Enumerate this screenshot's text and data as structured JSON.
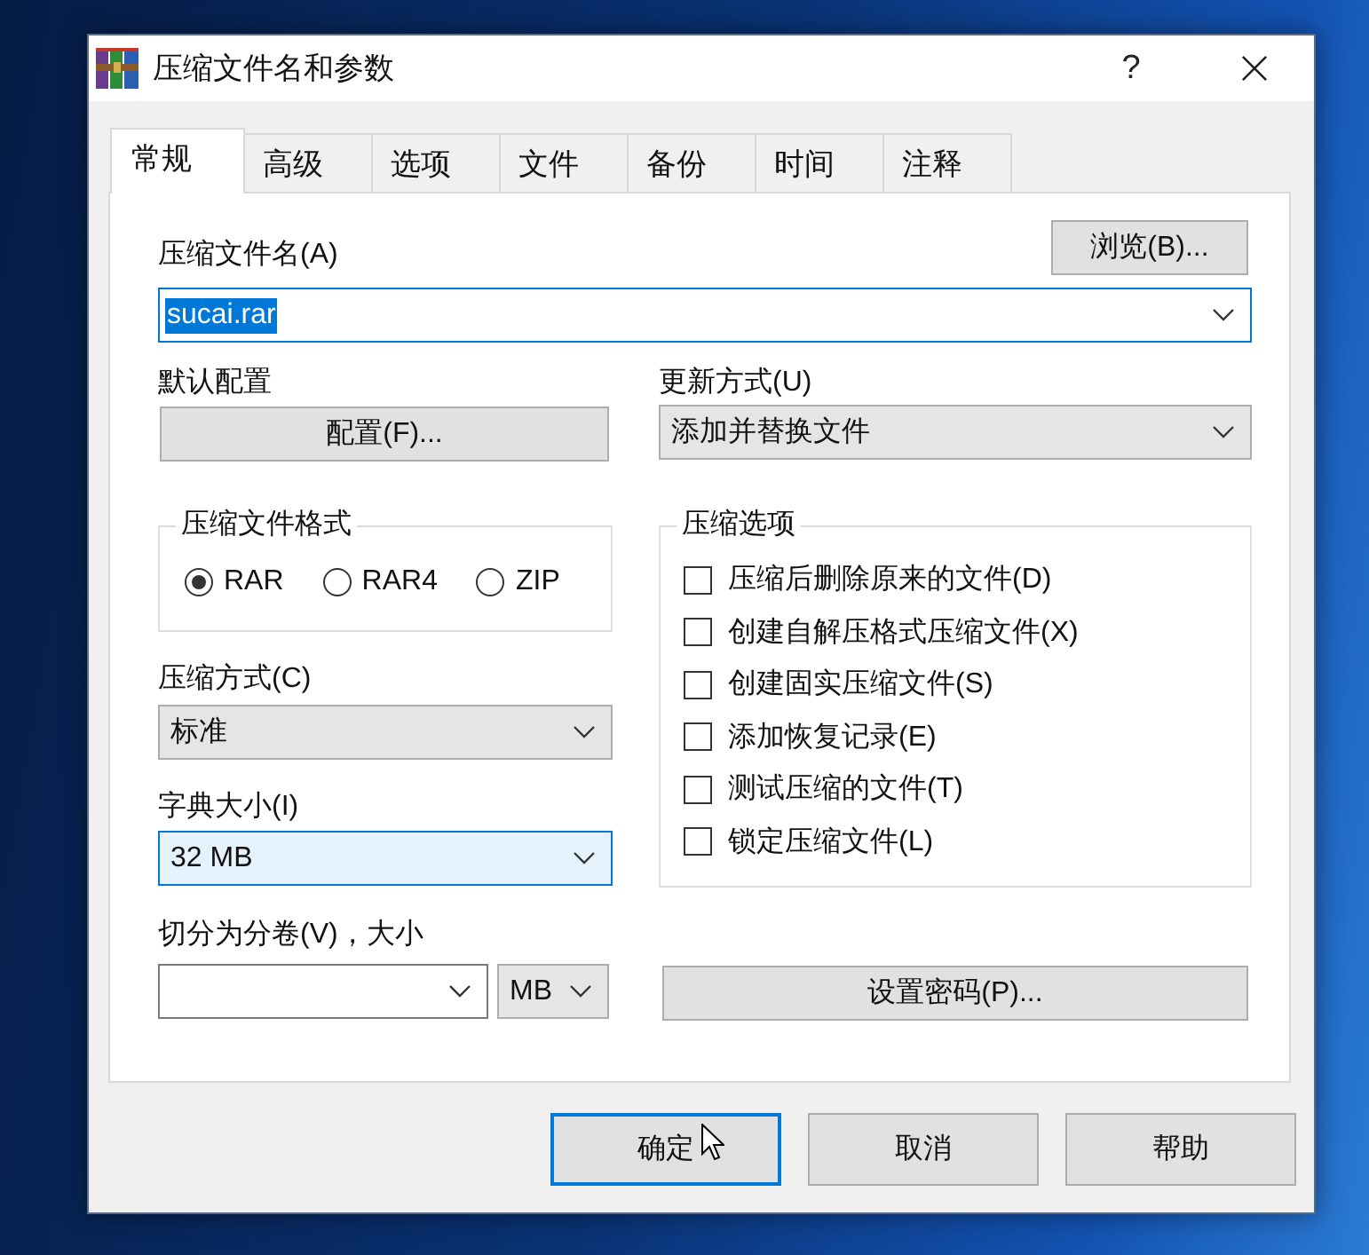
{
  "window": {
    "title": "压缩文件名和参数",
    "help_button": "?"
  },
  "tabs": [
    {
      "label": "常规",
      "selected": true
    },
    {
      "label": "高级",
      "selected": false
    },
    {
      "label": "选项",
      "selected": false
    },
    {
      "label": "文件",
      "selected": false
    },
    {
      "label": "备份",
      "selected": false
    },
    {
      "label": "时间",
      "selected": false
    },
    {
      "label": "注释",
      "selected": false
    }
  ],
  "archive_name": {
    "label": "压缩文件名(A)",
    "value": "sucai.rar",
    "focused": true,
    "browse_button": "浏览(B)..."
  },
  "profiles": {
    "label": "默认配置",
    "button": "配置(F)..."
  },
  "update_mode": {
    "label": "更新方式(U)",
    "value": "添加并替换文件",
    "highlighted": false
  },
  "archive_format": {
    "title": "压缩文件格式",
    "options": [
      {
        "label": "RAR",
        "selected": true
      },
      {
        "label": "RAR4",
        "selected": false
      },
      {
        "label": "ZIP",
        "selected": false
      }
    ]
  },
  "compression_method": {
    "label": "压缩方式(C)",
    "value": "标准",
    "highlighted": false
  },
  "dictionary_size": {
    "label": "字典大小(I)",
    "value": "32 MB",
    "highlighted": true
  },
  "archiving_options": {
    "title": "压缩选项",
    "options": [
      {
        "label": "压缩后删除原来的文件(D)",
        "checked": false
      },
      {
        "label": "创建自解压格式压缩文件(X)",
        "checked": false
      },
      {
        "label": "创建固实压缩文件(S)",
        "checked": false
      },
      {
        "label": "添加恢复记录(E)",
        "checked": false
      },
      {
        "label": "测试压缩的文件(T)",
        "checked": false
      },
      {
        "label": "锁定压缩文件(L)",
        "checked": false
      }
    ]
  },
  "split_volumes": {
    "label": "切分为分卷(V)，大小",
    "unit": "MB"
  },
  "password_button": "设置密码(P)...",
  "buttons": [
    {
      "label": "确定",
      "default": true
    },
    {
      "label": "取消",
      "default": false
    },
    {
      "label": "帮助",
      "default": false
    }
  ]
}
